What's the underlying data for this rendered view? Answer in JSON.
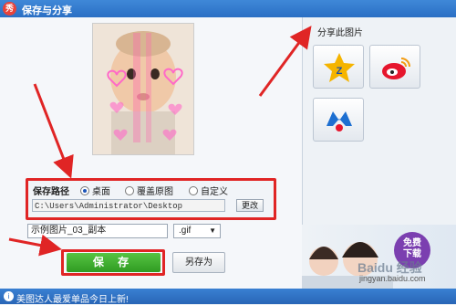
{
  "window": {
    "app_icon": "秀",
    "title": "保存与分享"
  },
  "save": {
    "group_label": "保存路径",
    "options": [
      "桌面",
      "覆盖原图",
      "自定义"
    ],
    "selected": "桌面",
    "path": "C:\\Users\\Administrator\\Desktop",
    "change_label": "更改",
    "filename": "示例图片_03_副本",
    "format": ".gif",
    "save_label": "保 存",
    "save_as_label": "另存为"
  },
  "share": {
    "label": "分享此图片",
    "targets": [
      {
        "icon": "qzone-icon",
        "color": "#f5b400"
      },
      {
        "icon": "weibo-icon",
        "color": "#e6162d"
      },
      {
        "icon": "share-service-icon",
        "color": "#1d6fd1"
      }
    ]
  },
  "promo": {
    "badge_line1": "免费",
    "badge_line2": "下载"
  },
  "status": {
    "text": "美图达人最爱单品今日上新!"
  },
  "watermark": {
    "logo": "Baidu 经验",
    "url": "jingyan.baidu.com"
  },
  "colors": {
    "title_bar": "#2a6fc4",
    "highlight_red": "#e02525",
    "save_green": "#3aa82a",
    "promo_purple": "#7b3fb0"
  }
}
